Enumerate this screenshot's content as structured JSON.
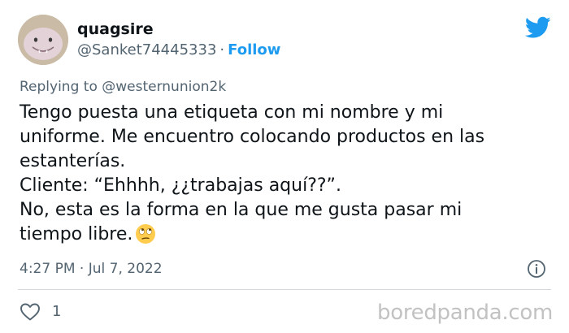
{
  "header": {
    "display_name": "quagsire",
    "handle": "@Sanket74445333",
    "separator": "·",
    "follow_label": "Follow",
    "avatar_icon": "quagsire-avatar",
    "platform_icon": "twitter-bird-icon",
    "brand_color": "#1d9bf0"
  },
  "reply": {
    "prefix": "Replying to",
    "mention": "@westernunion2k"
  },
  "body": {
    "lines": [
      "Tengo puesta una etiqueta con mi nombre y mi",
      "uniforme. Me encuentro colocando productos en las",
      "estanterías.",
      "Cliente: “Ehhhh, ¿¿trabajas aquí??”.",
      "No, esta es la forma en la que me gusta pasar mi",
      "tiempo libre."
    ],
    "emoji": "face-with-rolling-eyes"
  },
  "meta": {
    "time": "4:27 PM",
    "separator": "·",
    "date": "Jul 7, 2022",
    "info_icon": "info-icon"
  },
  "actions": {
    "like_icon": "heart-icon",
    "like_count": "1"
  },
  "watermark": "boredpanda.com"
}
